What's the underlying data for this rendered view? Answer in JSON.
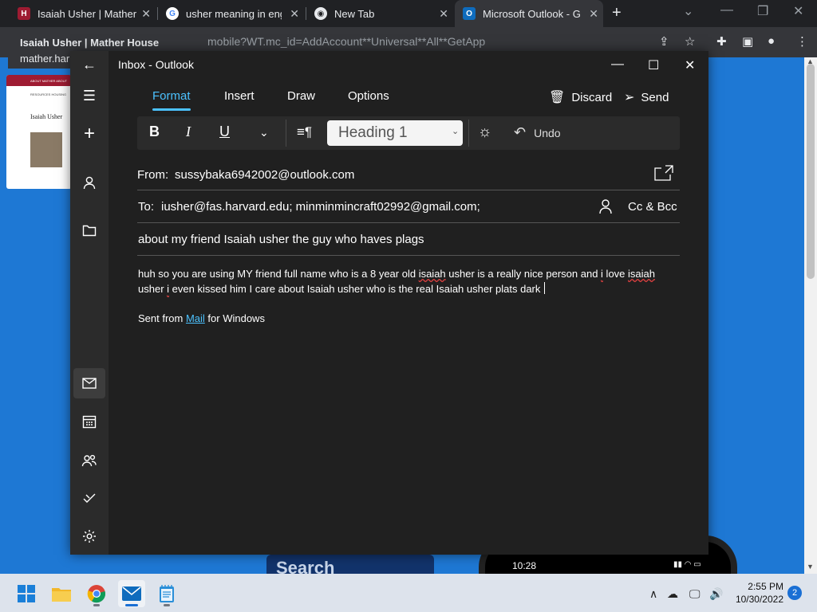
{
  "browser": {
    "tabs": [
      {
        "title": "Isaiah Usher | Mather House"
      },
      {
        "title": "usher meaning in english"
      },
      {
        "title": "New Tab"
      },
      {
        "title": "Microsoft Outlook - Get"
      }
    ],
    "url": "mobile?WT.mc_id=AddAccount**Universal**All**GetApp",
    "hover_card": {
      "title": "Isaiah Usher | Mather House",
      "url": "mather.har"
    },
    "thumbnail": {
      "title": "Isaiah Usher",
      "nav_text": "ABOUT   MATHER   ABOUT",
      "sub_text": "RESOURCES   HOUSING"
    },
    "phone_search": "Search",
    "phone_time": "10:28"
  },
  "mail": {
    "window_title": "Inbox - Outlook",
    "ribbon_tabs": [
      {
        "label": "Format",
        "active": true
      },
      {
        "label": "Insert",
        "active": false
      },
      {
        "label": "Draw",
        "active": false
      },
      {
        "label": "Options",
        "active": false
      }
    ],
    "actions": {
      "discard": "Discard",
      "send": "Send"
    },
    "toolbar": {
      "bold": "B",
      "italic": "I",
      "underline": "U",
      "style": "Heading 1",
      "undo": "Undo"
    },
    "from_label": "From:",
    "from": "sussybaka6942002@outlook.com",
    "to_label": "To:",
    "to": "iusher@fas.harvard.edu; minminmincraft02992@gmail.com;",
    "cc_bcc": "Cc & Bcc",
    "subject": "about my friend Isaiah usher the guy who haves plags",
    "body": {
      "p1": "huh so you are using MY friend full name who is a 8 year old ",
      "w1": "isaiah",
      "p2": " usher is a really nice person and ",
      "w2": "i",
      "p3": " love ",
      "w3": "isaiah",
      "p4": " usher ",
      "w4": "i",
      "p5": " even kissed him I care about Isaiah usher who is the real Isaiah usher plats dark"
    },
    "signature": {
      "before": "Sent from ",
      "link": "Mail",
      "after": " for Windows"
    }
  },
  "taskbar": {
    "time": "2:55 PM",
    "date": "10/30/2022",
    "notification_count": "2"
  }
}
